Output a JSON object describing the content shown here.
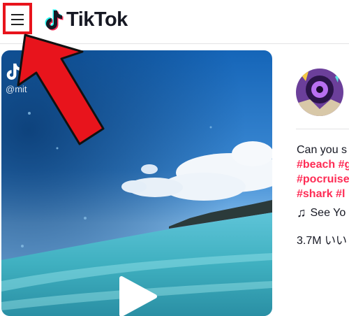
{
  "header": {
    "logo_text": "TikTok"
  },
  "video": {
    "watermark_handle": "@mit"
  },
  "panel": {
    "caption": "Can you s",
    "tags_line1": [
      "#beach",
      "#g"
    ],
    "tags_line2": [
      "#pocruise"
    ],
    "tags_line3": [
      "#shark",
      "#l"
    ],
    "music_text": "See Yo",
    "likes_text": "3.7M いい"
  },
  "colors": {
    "accent_red": "#e8141c",
    "tag_pink": "#fe2c55",
    "tiktok_cyan": "#25f4ee",
    "tiktok_pink": "#fe2c55"
  },
  "icons": {
    "menu": "hamburger-icon",
    "logo": "tiktok-note-icon",
    "play": "play-icon",
    "music": "music-note-icon"
  }
}
